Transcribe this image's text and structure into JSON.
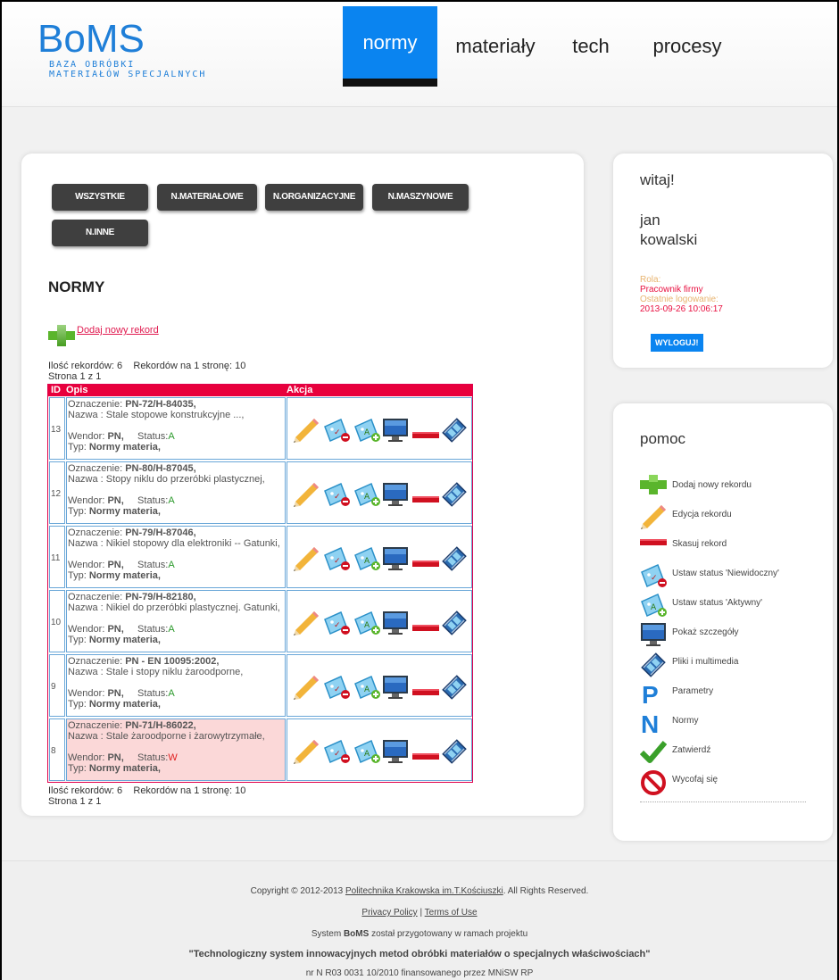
{
  "logo": {
    "main": "BoMS",
    "sub1": "BAZA OBRÓBKI",
    "sub2": "MATERIAŁÓW SPECJALNYCH"
  },
  "nav": [
    {
      "label": "normy",
      "active": true
    },
    {
      "label": "materiały",
      "active": false
    },
    {
      "label": "tech",
      "active": false
    },
    {
      "label": "procesy",
      "active": false
    }
  ],
  "filters": [
    "WSZYSTKIE",
    "N.MATERIAŁOWE",
    "N.ORGANIZACYJNE",
    "N.MASZYNOWE",
    "N.INNE"
  ],
  "section_title": "NORMY",
  "add_record": "Dodaj nowy rekord",
  "pager_top": {
    "line1": "Ilość rekordów: 6    Rekordów na 1 stronę: 10",
    "line2": "Strona 1 z 1"
  },
  "pager_bottom": {
    "line1": "Ilość rekordów: 6    Rekordów na 1 stronę: 10",
    "line2": "Strona 1 z 1"
  },
  "table": {
    "headers": {
      "id": "ID",
      "desc": "Opis",
      "action": "Akcja"
    },
    "rows": [
      {
        "id": "13",
        "oznaczenie": "PN-72/H-84035,",
        "nazwa": "Nazwa : Stale stopowe konstrukcyjne ...,",
        "wendor": "PN,",
        "status": "A",
        "typ": "Normy materia,",
        "warn": false
      },
      {
        "id": "12",
        "oznaczenie": "PN-80/H-87045,",
        "nazwa": "Nazwa : Stopy niklu do przeróbki plastycznej,",
        "wendor": "PN,",
        "status": "A",
        "typ": "Normy materia,",
        "warn": false
      },
      {
        "id": "11",
        "oznaczenie": "PN-79/H-87046,",
        "nazwa": "Nazwa : Nikiel stopowy dla elektroniki -- Gatunki,",
        "wendor": "PN,",
        "status": "A",
        "typ": "Normy materia,",
        "warn": false
      },
      {
        "id": "10",
        "oznaczenie": "PN-79/H-82180,",
        "nazwa": "Nazwa : Nikiel do przeróbki plastycznej. Gatunki,",
        "wendor": "PN,",
        "status": "A",
        "typ": "Normy materia,",
        "warn": false
      },
      {
        "id": "9",
        "oznaczenie": "PN - EN 10095:2002,",
        "nazwa": "Nazwa : Stale i stopy niklu żaroodporne,",
        "wendor": "PN,",
        "status": "A",
        "typ": "Normy materia,",
        "warn": false
      },
      {
        "id": "8",
        "oznaczenie": "PN-71/H-86022,",
        "nazwa": "Nazwa : Stale żaroodporne i żarowytrzymałe,",
        "wendor": "PN,",
        "status": "W",
        "typ": "Normy materia,",
        "warn": true
      }
    ],
    "labels": {
      "oznaczenie": "Oznaczenie: ",
      "wendor": "Wendor: ",
      "status": "Status:",
      "typ": "Typ: "
    }
  },
  "welcome": {
    "title": "witaj!",
    "first_name": "jan",
    "last_name": "kowalski",
    "role_label": "Rola:",
    "role": "Pracownik firmy",
    "last_login_label": "Ostatnie logowanie:",
    "last_login": "2013-09-26 10:06:17",
    "logout": "WYLOGUJ!"
  },
  "help": {
    "title": "pomoc",
    "items": [
      {
        "icon": "plus-icon",
        "label": "Dodaj nowy rekordu"
      },
      {
        "icon": "pencil-icon",
        "label": "Edycja rekordu"
      },
      {
        "icon": "minus-icon",
        "label": "Skasuj rekord"
      },
      {
        "icon": "status-hidden-icon",
        "label": "Ustaw status 'Niewidoczny'"
      },
      {
        "icon": "status-active-icon",
        "label": "Ustaw status 'Aktywny'"
      },
      {
        "icon": "monitor-icon",
        "label": "Pokaż szczegóły"
      },
      {
        "icon": "film-icon",
        "label": "Pliki i multimedia"
      },
      {
        "icon": "p-letter-icon",
        "label": "Parametry"
      },
      {
        "icon": "n-letter-icon",
        "label": "Normy"
      },
      {
        "icon": "checkmark-icon",
        "label": "Zatwierdź"
      },
      {
        "icon": "no-entry-icon",
        "label": "Wycofaj się"
      }
    ]
  },
  "footer": {
    "copyright_pre": "Copyright © 2012-2013 ",
    "copyright_link": "Politechnika Krakowska im.T.Kościuszki",
    "copyright_post": ". All Rights Reserved.",
    "privacy": "Privacy Policy",
    "sep": " | ",
    "terms": "Terms of Use",
    "system_pre": "System ",
    "system_bold": "BoMS",
    "system_post": " został przygotowany w ramach projektu",
    "project": "\"Technologiczny system innowacyjnych metod obróbki materiałów o specjalnych właściwościach\"",
    "grant": "nr N R03 0031 10/2010 finansowanego przez MNiSW RP"
  },
  "colors": {
    "brand": "#1f7fd8",
    "nav_active": "#0a84f0",
    "table_header": "#e8003c",
    "warn_row": "#fbd8d8"
  }
}
